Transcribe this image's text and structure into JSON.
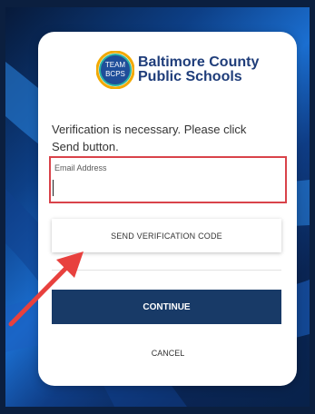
{
  "organization": {
    "logo_text": "TEAM BCPS",
    "name_line1": "Baltimore County",
    "name_line2": "Public Schools"
  },
  "form": {
    "instructions": "Verification is necessary. Please click Send button.",
    "email_label": "Email Address",
    "email_value": "",
    "send_button_label": "SEND VERIFICATION CODE",
    "continue_button_label": "CONTINUE",
    "cancel_button_label": "CANCEL"
  },
  "colors": {
    "brand_navy": "#183a67",
    "highlight_red": "#d9434a",
    "annotation_arrow": "#e8413e"
  }
}
